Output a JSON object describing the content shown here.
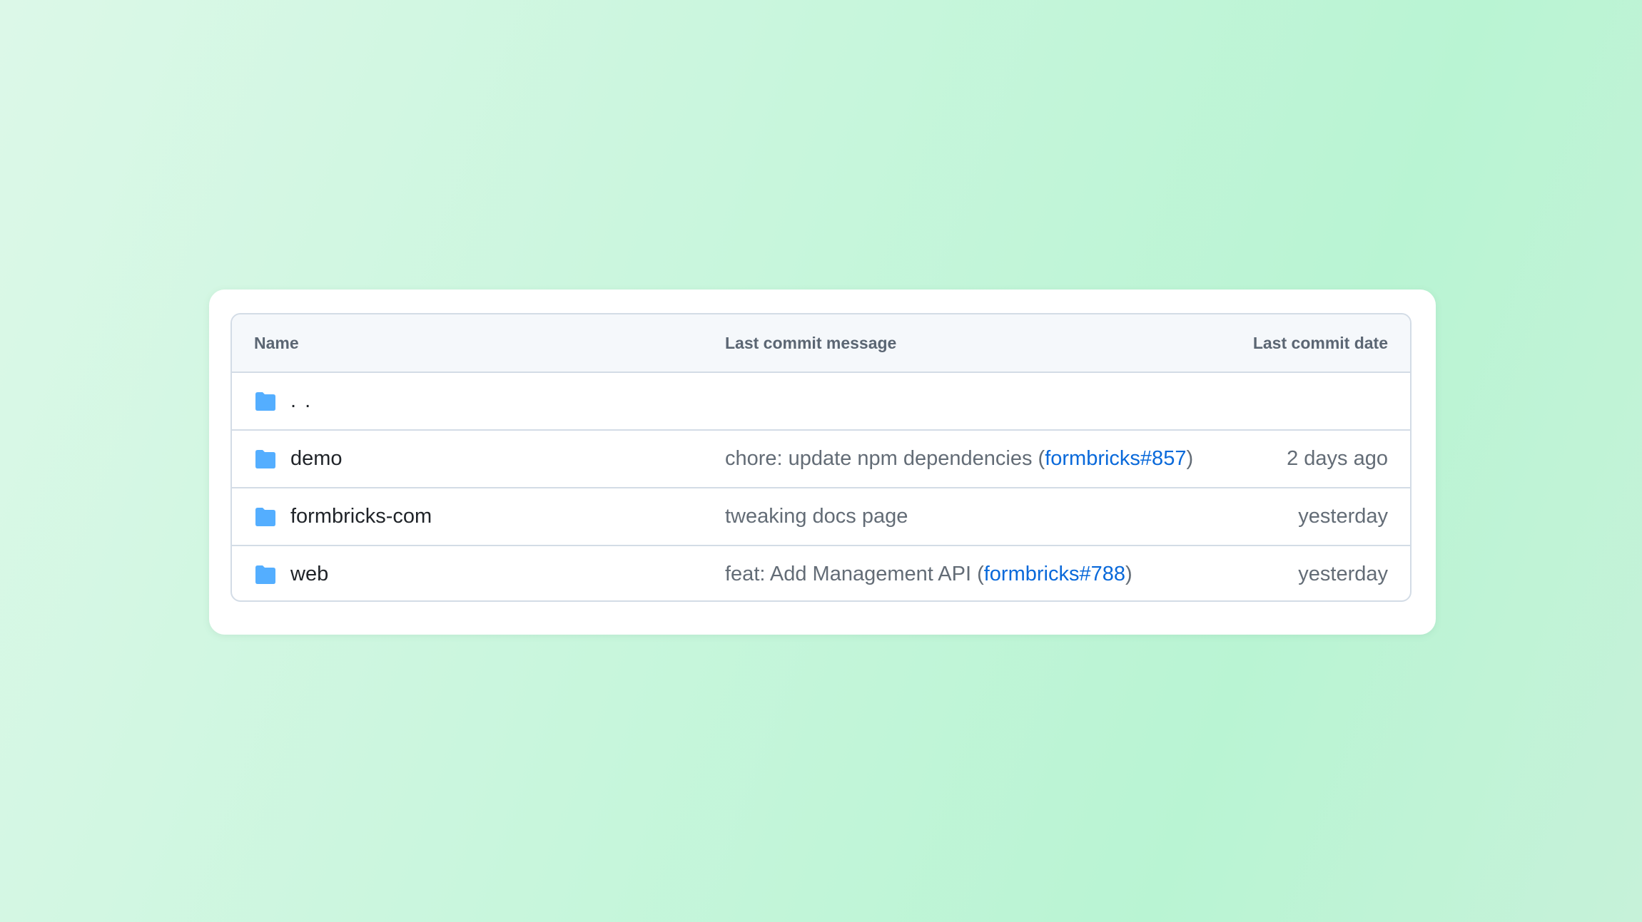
{
  "table": {
    "headers": {
      "name": "Name",
      "message": "Last commit message",
      "date": "Last commit date"
    },
    "parent_row": {
      "name": ". ."
    },
    "rows": [
      {
        "name": "demo",
        "message_prefix": "chore: update npm dependencies (",
        "message_link": "formbricks#857",
        "message_suffix": ")",
        "date": "2 days ago"
      },
      {
        "name": "formbricks-com",
        "message_prefix": "tweaking docs page",
        "message_link": "",
        "message_suffix": "",
        "date": "yesterday"
      },
      {
        "name": "web",
        "message_prefix": "feat: Add Management API (",
        "message_link": "formbricks#788",
        "message_suffix": ")",
        "date": "yesterday"
      }
    ]
  },
  "icons": {
    "folder": "folder-icon"
  },
  "colors": {
    "folder": "#54aeff",
    "link": "#0969da",
    "text": "#1f2328",
    "muted": "#636c76"
  }
}
